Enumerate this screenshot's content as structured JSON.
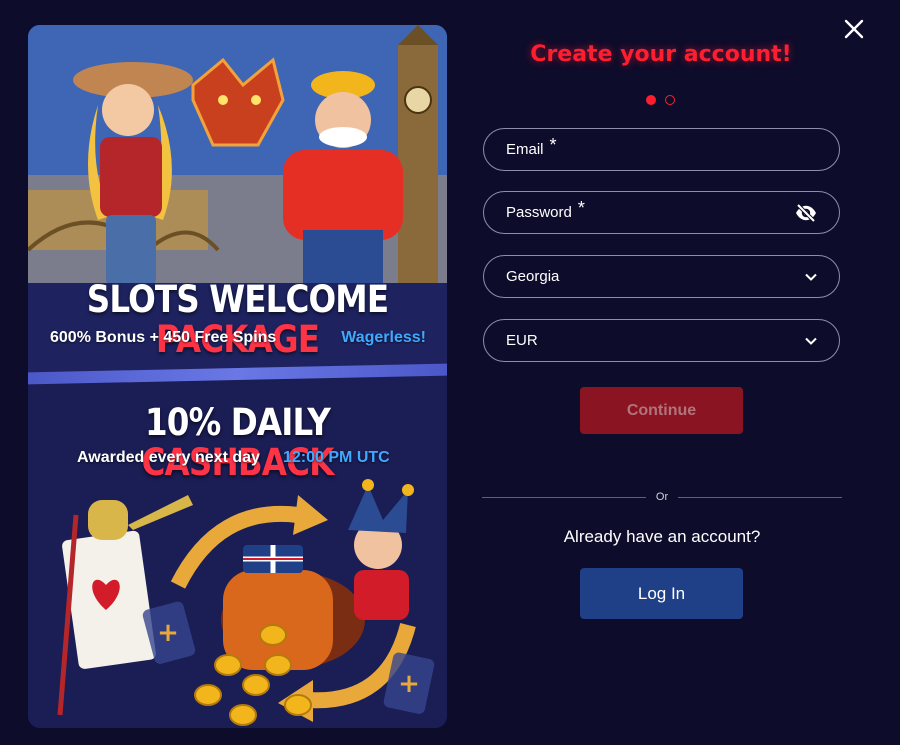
{
  "promo": {
    "headline1_white": "SLOTS WELCOME ",
    "headline1_red": "PACKAGE",
    "sub1_left": "600% Bonus + 450 Free Spins",
    "sub1_right": "Wagerless!",
    "headline2_white": "10% DAILY ",
    "headline2_red": "CASHBACK",
    "sub2_left": "Awarded every next day",
    "sub2_right": "12:00 PM UTC"
  },
  "form": {
    "title": "Create your account!",
    "steps_total": 2,
    "step_current": 1,
    "email_label": "Email",
    "password_label": "Password",
    "required_mark": "*",
    "country_value": "Georgia",
    "currency_value": "EUR",
    "continue_label": "Continue",
    "or_label": "Or",
    "already_text": "Already have an account?",
    "login_label": "Log In"
  },
  "colors": {
    "background": "#0e0c2b",
    "accent_red": "#ff1e2f",
    "continue_disabled": "#8b1422",
    "login_blue": "#1f3f87",
    "promo_highlight_blue": "#3fa9ff"
  },
  "icons": {
    "close": "close-icon",
    "password_toggle": "eye-slash-icon",
    "select": "chevron-down-icon"
  }
}
